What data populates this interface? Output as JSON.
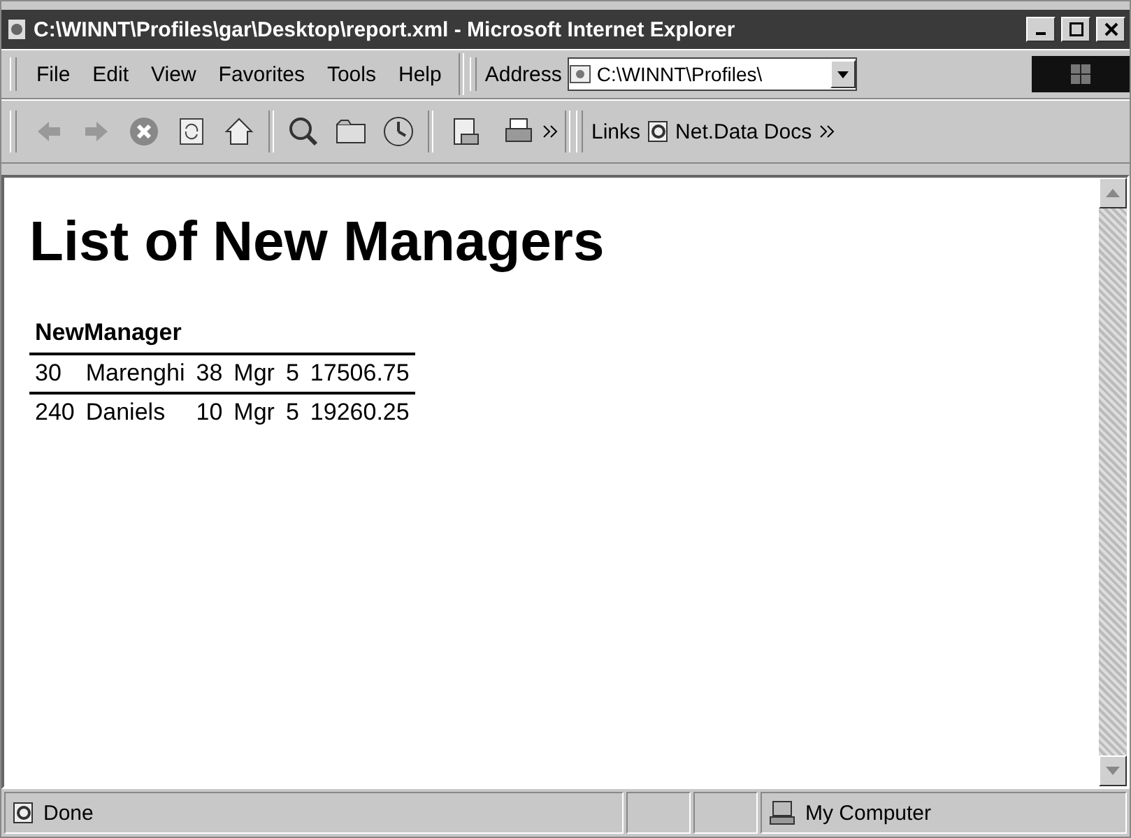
{
  "window": {
    "title": "C:\\WINNT\\Profiles\\gar\\Desktop\\report.xml - Microsoft Internet Explorer"
  },
  "menu": [
    "File",
    "Edit",
    "View",
    "Favorites",
    "Tools",
    "Help"
  ],
  "address": {
    "label": "Address",
    "value": "C:\\WINNT\\Profiles\\"
  },
  "links": {
    "label": "Links",
    "items": [
      "Net.Data Docs"
    ]
  },
  "page": {
    "heading": "List of New Managers",
    "table": {
      "header": "NewManager",
      "rows": [
        [
          "30",
          "Marenghi",
          "38",
          "Mgr",
          "5",
          "17506.75"
        ],
        [
          "240",
          "Daniels",
          "10",
          "Mgr",
          "5",
          "19260.25"
        ]
      ]
    }
  },
  "status_bar": {
    "text": "Done",
    "zone": "My Computer"
  }
}
